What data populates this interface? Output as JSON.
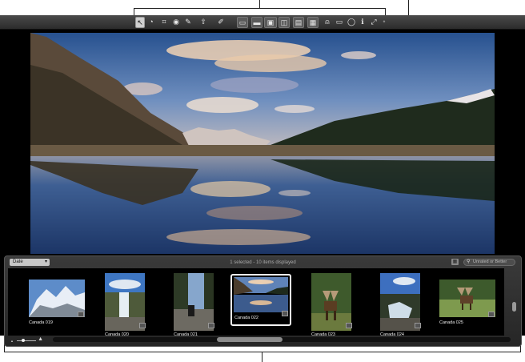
{
  "toolbar": {
    "tools": [
      {
        "name": "select-tool",
        "glyph": "↖"
      },
      {
        "name": "straighten-tool",
        "glyph": "◔"
      },
      {
        "name": "crop-tool",
        "glyph": "⌗"
      },
      {
        "name": "redeye-tool",
        "glyph": "◉"
      },
      {
        "name": "retouch-tool",
        "glyph": "✎"
      },
      {
        "name": "lift-stamp-tool",
        "glyph": "⇧"
      },
      {
        "name": "eyedropper-tool",
        "glyph": "✐"
      }
    ],
    "view_modes": [
      "▭",
      "▬",
      "▣",
      "◫",
      "▤",
      "▦"
    ],
    "right_icons": [
      "⍝",
      "▭",
      "◯",
      "ℹ",
      "⤢",
      "•"
    ]
  },
  "browser": {
    "sort_label": "Date",
    "status_text": "1 selected - 10 items displayed",
    "search_placeholder": "Unrated or Better",
    "thumbnails": [
      {
        "label": "Canada 019",
        "selected": false
      },
      {
        "label": "Canada 020",
        "selected": false
      },
      {
        "label": "Canada 021",
        "selected": false
      },
      {
        "label": "Canada 022",
        "selected": true
      },
      {
        "label": "Canada 023",
        "selected": false
      },
      {
        "label": "Canada 024",
        "selected": false
      },
      {
        "label": "Canada 025",
        "selected": false
      }
    ]
  }
}
